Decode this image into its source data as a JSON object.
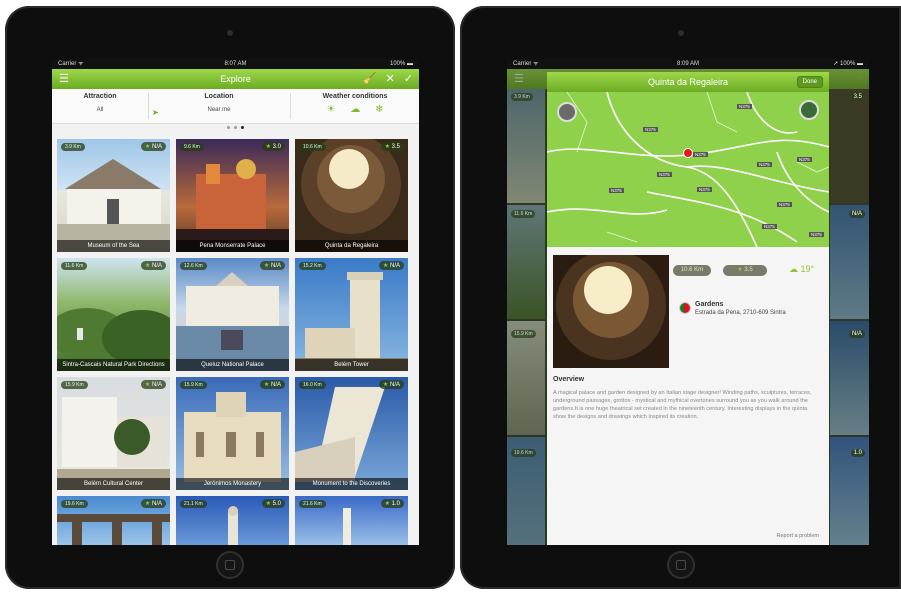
{
  "left": {
    "status": {
      "carrier": "Carrier ᯤ",
      "time": "8:07 AM",
      "battery": "100% ▬"
    },
    "nav": {
      "title": "Explore",
      "menu_icon": "☰",
      "actions": [
        "🧹",
        "✕",
        "✓"
      ]
    },
    "filters": {
      "attraction": {
        "label": "Attraction",
        "value": "All"
      },
      "location": {
        "label": "Location",
        "value": "Near me"
      },
      "weather": {
        "label": "Weather conditions",
        "icons": [
          "☀",
          "☁",
          "❄"
        ]
      }
    },
    "tiles": [
      {
        "distance": "3.9 Km",
        "rating": "N/A",
        "name": "Museum of the Sea"
      },
      {
        "distance": "9.6 Km",
        "rating": "3.0",
        "name": "Pena Monserrate Palace"
      },
      {
        "distance": "10.6 Km",
        "rating": "3.5",
        "name": "Quinta da Regaleira"
      },
      {
        "distance": "11.6 Km",
        "rating": "N/A",
        "name": "Sintra-Cascais Natural Park Directions"
      },
      {
        "distance": "12.6 Km",
        "rating": "N/A",
        "name": "Queluz National Palace"
      },
      {
        "distance": "15.2 Km",
        "rating": "N/A",
        "name": "Belém Tower"
      },
      {
        "distance": "15.9 Km",
        "rating": "N/A",
        "name": "Belém Cultural Center"
      },
      {
        "distance": "15.9 Km",
        "rating": "N/A",
        "name": "Jerónimos Monastery"
      },
      {
        "distance": "16.0 Km",
        "rating": "N/A",
        "name": "Monument to the Discoveries"
      },
      {
        "distance": "19.6 Km",
        "rating": "N/A",
        "name": ""
      },
      {
        "distance": "21.1 Km",
        "rating": "5.0",
        "name": ""
      },
      {
        "distance": "21.6 Km",
        "rating": "1.0",
        "name": ""
      }
    ]
  },
  "right": {
    "status": {
      "carrier": "Carrier ᯤ",
      "time": "8:09 AM",
      "battery": "➚ 100% ▬"
    },
    "modal": {
      "title": "Quinta da Regaleira",
      "done": "Done",
      "distance": "10.6 Km",
      "rating": "3.5",
      "temperature": "19°",
      "category": "Gardens",
      "address": "Estrada da Pena, 2710-609 Sintra",
      "overview_title": "Overview",
      "overview_text": "A magical palace and garden designed by an Italian stage designer! Winding paths, sculptures, terraces, underground passages, grottos - mystical and mythical overtones surround you as you walk around the gardens.It is one huge theatrical set created in the nineteenth century. Interesting displays in the quinta show the designs and drawings which inspired its creation.",
      "report": "Report a problem",
      "map_labels": [
        "N375",
        "N375",
        "N375",
        "N375",
        "N375",
        "N375",
        "N375",
        "N375",
        "N375",
        "N375",
        "N375"
      ]
    },
    "bg_ratings": [
      "3.5",
      "N/A",
      "N/A",
      "1.0"
    ],
    "bg_distances": [
      "3.9 Km",
      "11.6 Km",
      "15.9 Km",
      "19.6 Km"
    ]
  }
}
